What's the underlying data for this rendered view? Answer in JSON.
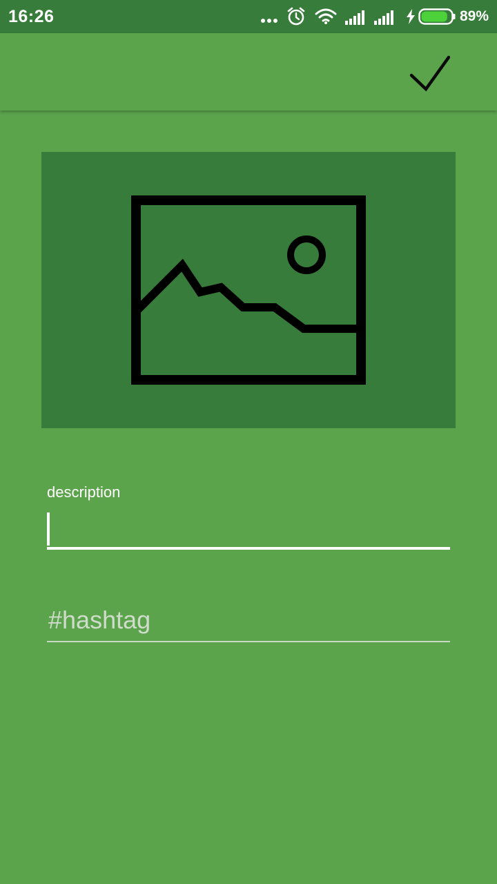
{
  "status_bar": {
    "time": "16:26",
    "battery_percent": "89%",
    "battery_level": 0.89,
    "icons": [
      "more-dots-icon",
      "alarm-icon",
      "wifi-icon",
      "signal-icon",
      "signal-icon",
      "charging-icon",
      "battery-icon"
    ]
  },
  "toolbar": {
    "confirm_icon": "check-icon"
  },
  "image_placeholder": {
    "icon": "image-icon"
  },
  "form": {
    "description_label": "description",
    "description_value": "",
    "hashtag_placeholder": "#hashtag",
    "hashtag_value": ""
  },
  "colors": {
    "primary": "#5ca44c",
    "primary_dark": "#377c3a",
    "accent": "#ffffff"
  }
}
